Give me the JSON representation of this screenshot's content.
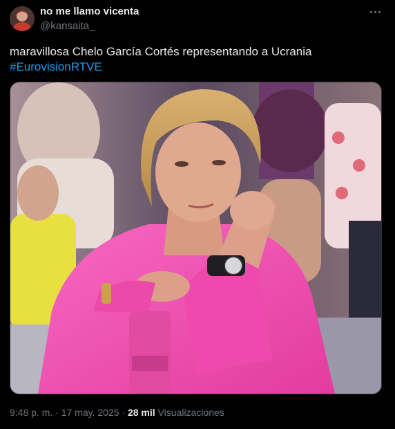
{
  "author": {
    "display_name": "no me llamo vicenta",
    "handle": "@kansaita_",
    "avatar_icon": "avatar-photo"
  },
  "more_icon": "more-horizontal-icon",
  "tweet": {
    "text": "maravillosa Chelo García Cortés representando a Ucrania",
    "hashtag": "#EurovisionRTVE"
  },
  "media": {
    "kind": "photo"
  },
  "footer": {
    "time": "9:48 p. m.",
    "separator": "·",
    "date": "17 may. 2025",
    "views_count": "28 mil",
    "views_label": "Visualizaciones"
  },
  "colors": {
    "background": "#000000",
    "text": "#e7e9ea",
    "secondary_text": "#71767b",
    "link": "#1d9bf0",
    "blouse_pink": "#f04ab0"
  }
}
